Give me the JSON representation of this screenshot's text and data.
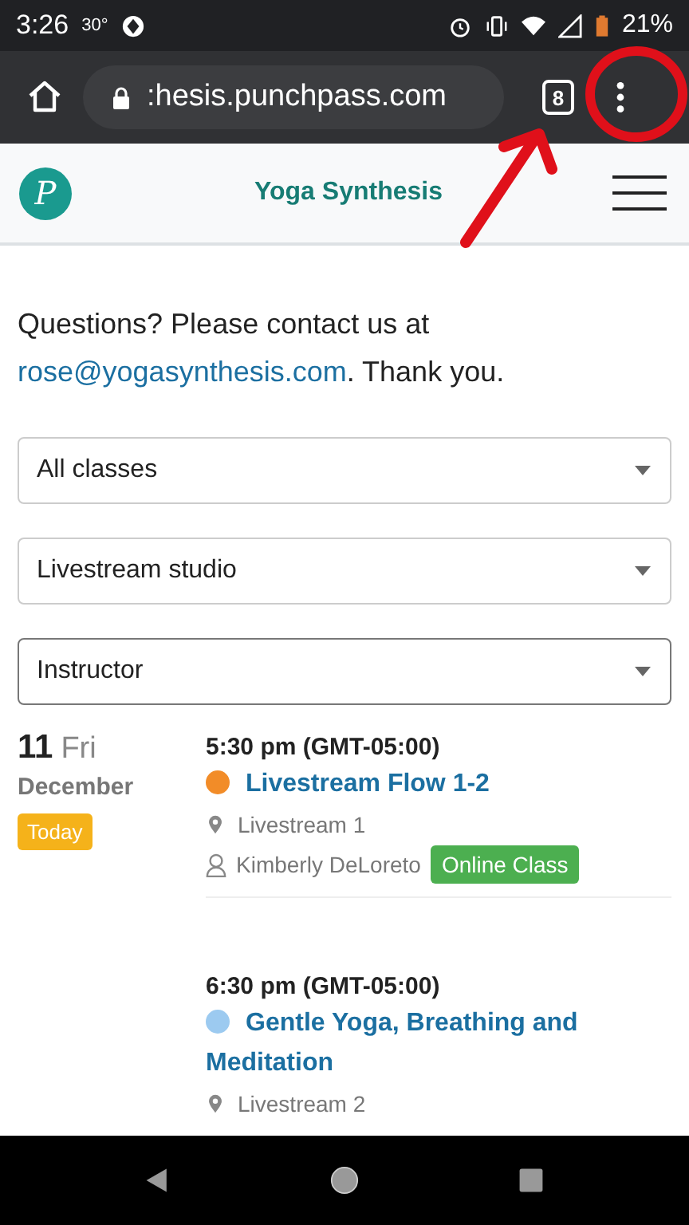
{
  "status_bar": {
    "time": "3:26",
    "temperature": "30°",
    "battery": "21%"
  },
  "browser": {
    "url": ":hesis.punchpass.com",
    "tab_count": "8"
  },
  "site_header": {
    "logo": "P",
    "title": "Yoga Synthesis"
  },
  "intro": {
    "text": "Questions? Please contact us at",
    "email": "rose@yogasynthesis.com",
    "after": ". Thank you."
  },
  "filters": [
    {
      "value": "All classes",
      "focused": false
    },
    {
      "value": "Livestream studio",
      "focused": false
    },
    {
      "value": "Instructor",
      "focused": true
    }
  ],
  "day": {
    "day_number": "11",
    "weekday": "Fri",
    "month": "December",
    "badge": "Today"
  },
  "events": [
    {
      "time": "5:30 pm (GMT-05:00)",
      "title": "Livestream Flow 1-2",
      "color": "#f28c28",
      "location": "Livestream 1",
      "instructor": "Kimberly DeLoreto",
      "tag": "Online Class"
    },
    {
      "time": "6:30 pm (GMT-05:00)",
      "title": "Gentle Yoga, Breathing and Meditation",
      "color": "#9ccaf0",
      "location": "Livestream 2"
    }
  ]
}
